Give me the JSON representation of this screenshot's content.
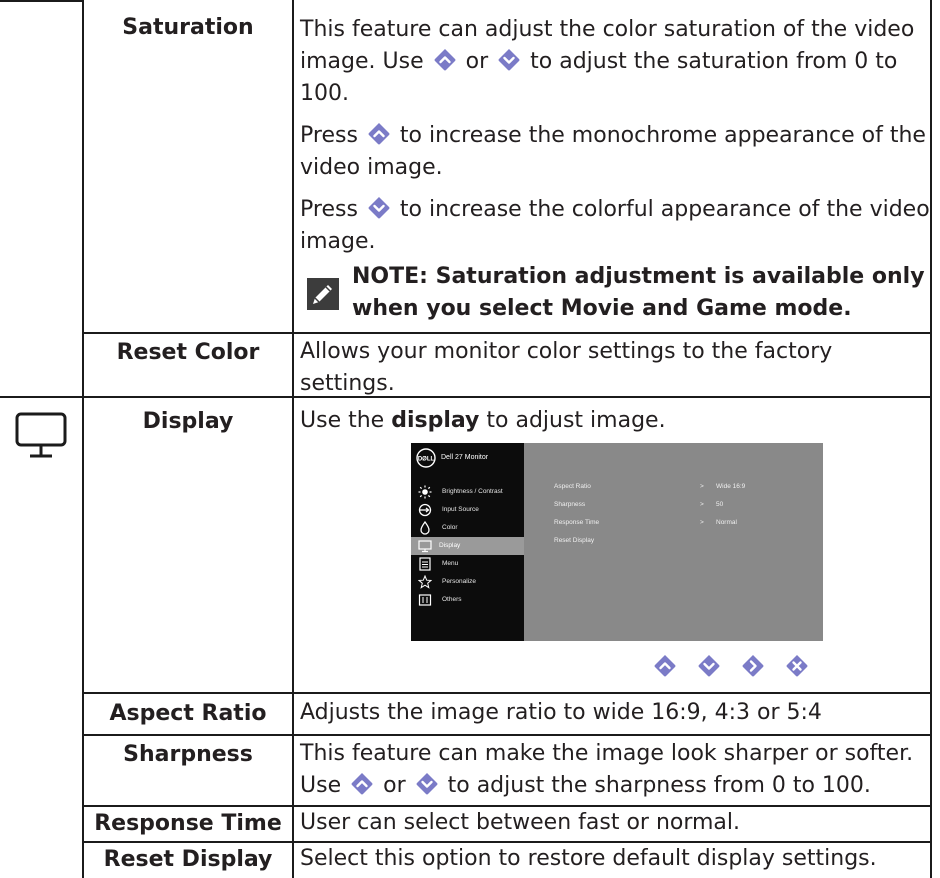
{
  "colors": {
    "ink": "#231f20",
    "button": "#7b7bc7",
    "osd_dark": "#0c0c0c",
    "osd_panel": "#898989"
  },
  "rows": {
    "saturation": {
      "label": "Saturation",
      "p1_a": "This feature can adjust the color saturation of the video image. Use",
      "p1_or": "or",
      "p1_b": "to adjust the saturation from 0 to 100.",
      "p2_a": "Press",
      "p2_b": "to increase the monochrome appearance of the video image.",
      "p3_a": "Press",
      "p3_b": "to increase the colorful appearance of the video image.",
      "note": "NOTE: Saturation adjustment is available only when you select Movie and Game mode."
    },
    "reset_color": {
      "label": "Reset Color",
      "text": "Allows your monitor color settings to the factory settings."
    },
    "display": {
      "label": "Display",
      "text_a": "Use the",
      "text_bold": "display",
      "text_b": "to adjust image."
    },
    "aspect_ratio": {
      "label": "Aspect Ratio",
      "text": "Adjusts the image ratio to wide 16:9, 4:3 or 5:4"
    },
    "sharpness": {
      "label": "Sharpness",
      "text_a": "This feature can make the image look sharper or softer. Use",
      "text_or": "or",
      "text_b": "to adjust the sharpness from 0 to 100."
    },
    "response_time": {
      "label": "Response Time",
      "text": "User can select between fast or normal."
    },
    "reset_display": {
      "label": "Reset Display",
      "text": "Select this option to restore default display settings."
    }
  },
  "osd": {
    "logo_text": "DØLL",
    "title": "Dell 27 Monitor",
    "menu": [
      {
        "label": "Brightness / Contrast",
        "icon": "brightness-icon"
      },
      {
        "label": "Input Source",
        "icon": "input-source-icon"
      },
      {
        "label": "Color",
        "icon": "color-icon"
      },
      {
        "label": "Display",
        "icon": "display-icon",
        "selected": true
      },
      {
        "label": "Menu",
        "icon": "menu-icon"
      },
      {
        "label": "Personalize",
        "icon": "star-icon"
      },
      {
        "label": "Others",
        "icon": "others-icon"
      }
    ],
    "settings": [
      {
        "label": "Aspect Ratio",
        "chevron": ">",
        "value": "Wide 16:9"
      },
      {
        "label": "Sharpness",
        "chevron": ">",
        "value": "50"
      },
      {
        "label": "Response Time",
        "chevron": ">",
        "value": "Normal"
      },
      {
        "label": "Reset Display"
      }
    ],
    "nav_buttons": [
      "up-button-icon",
      "down-button-icon",
      "right-button-icon",
      "close-button-icon"
    ]
  }
}
